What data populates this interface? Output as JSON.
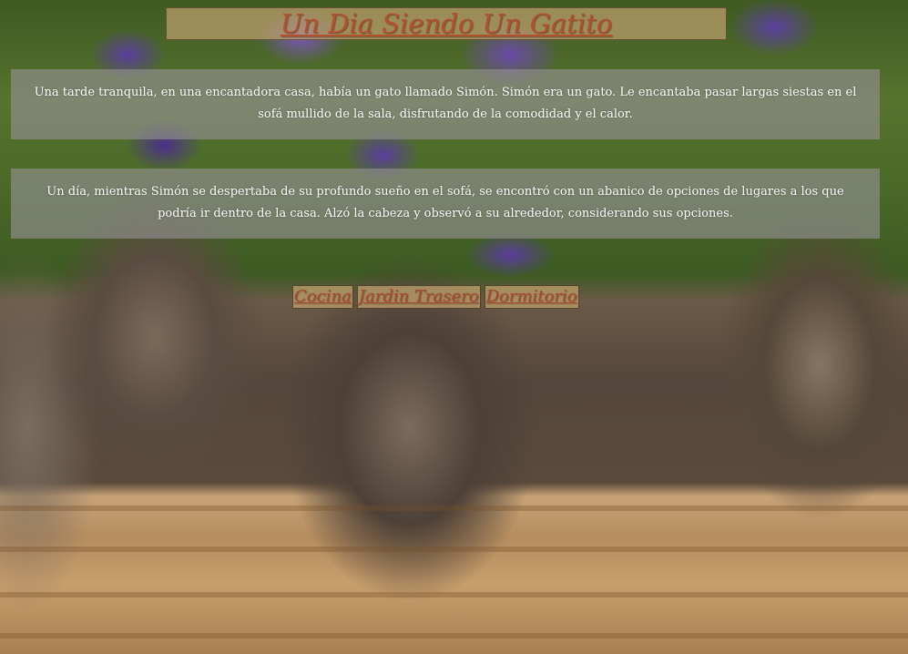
{
  "page": {
    "title": "Un Dia Siendo Un Gatito",
    "background": "photo of tabby kittens in a wicker basket in front of purple flowers"
  },
  "story": {
    "paragraph_1": "Una tarde tranquila, en una encantadora casa, había un gato llamado Simón. Simón era un gato. Le encantaba pasar largas siestas en el sofá mullido de la sala, disfrutando de la comodidad y el calor.",
    "paragraph_2": "Un día, mientras Simón se despertaba de su profundo sueño en el sofá, se encontró con un abanico de opciones de lugares a los que podría ir dentro de la casa. Alzó la cabeza y observó a su alrededor, considerando sus opciones."
  },
  "nav": {
    "links": [
      {
        "label": "Cocina"
      },
      {
        "label": "Jardin Trasero"
      },
      {
        "label": "Dormitorio"
      }
    ]
  },
  "colors": {
    "link_text": "#a8472a",
    "title_text": "#b5502e",
    "panel_tan": "#bea06e",
    "story_panel": "#96919b"
  }
}
